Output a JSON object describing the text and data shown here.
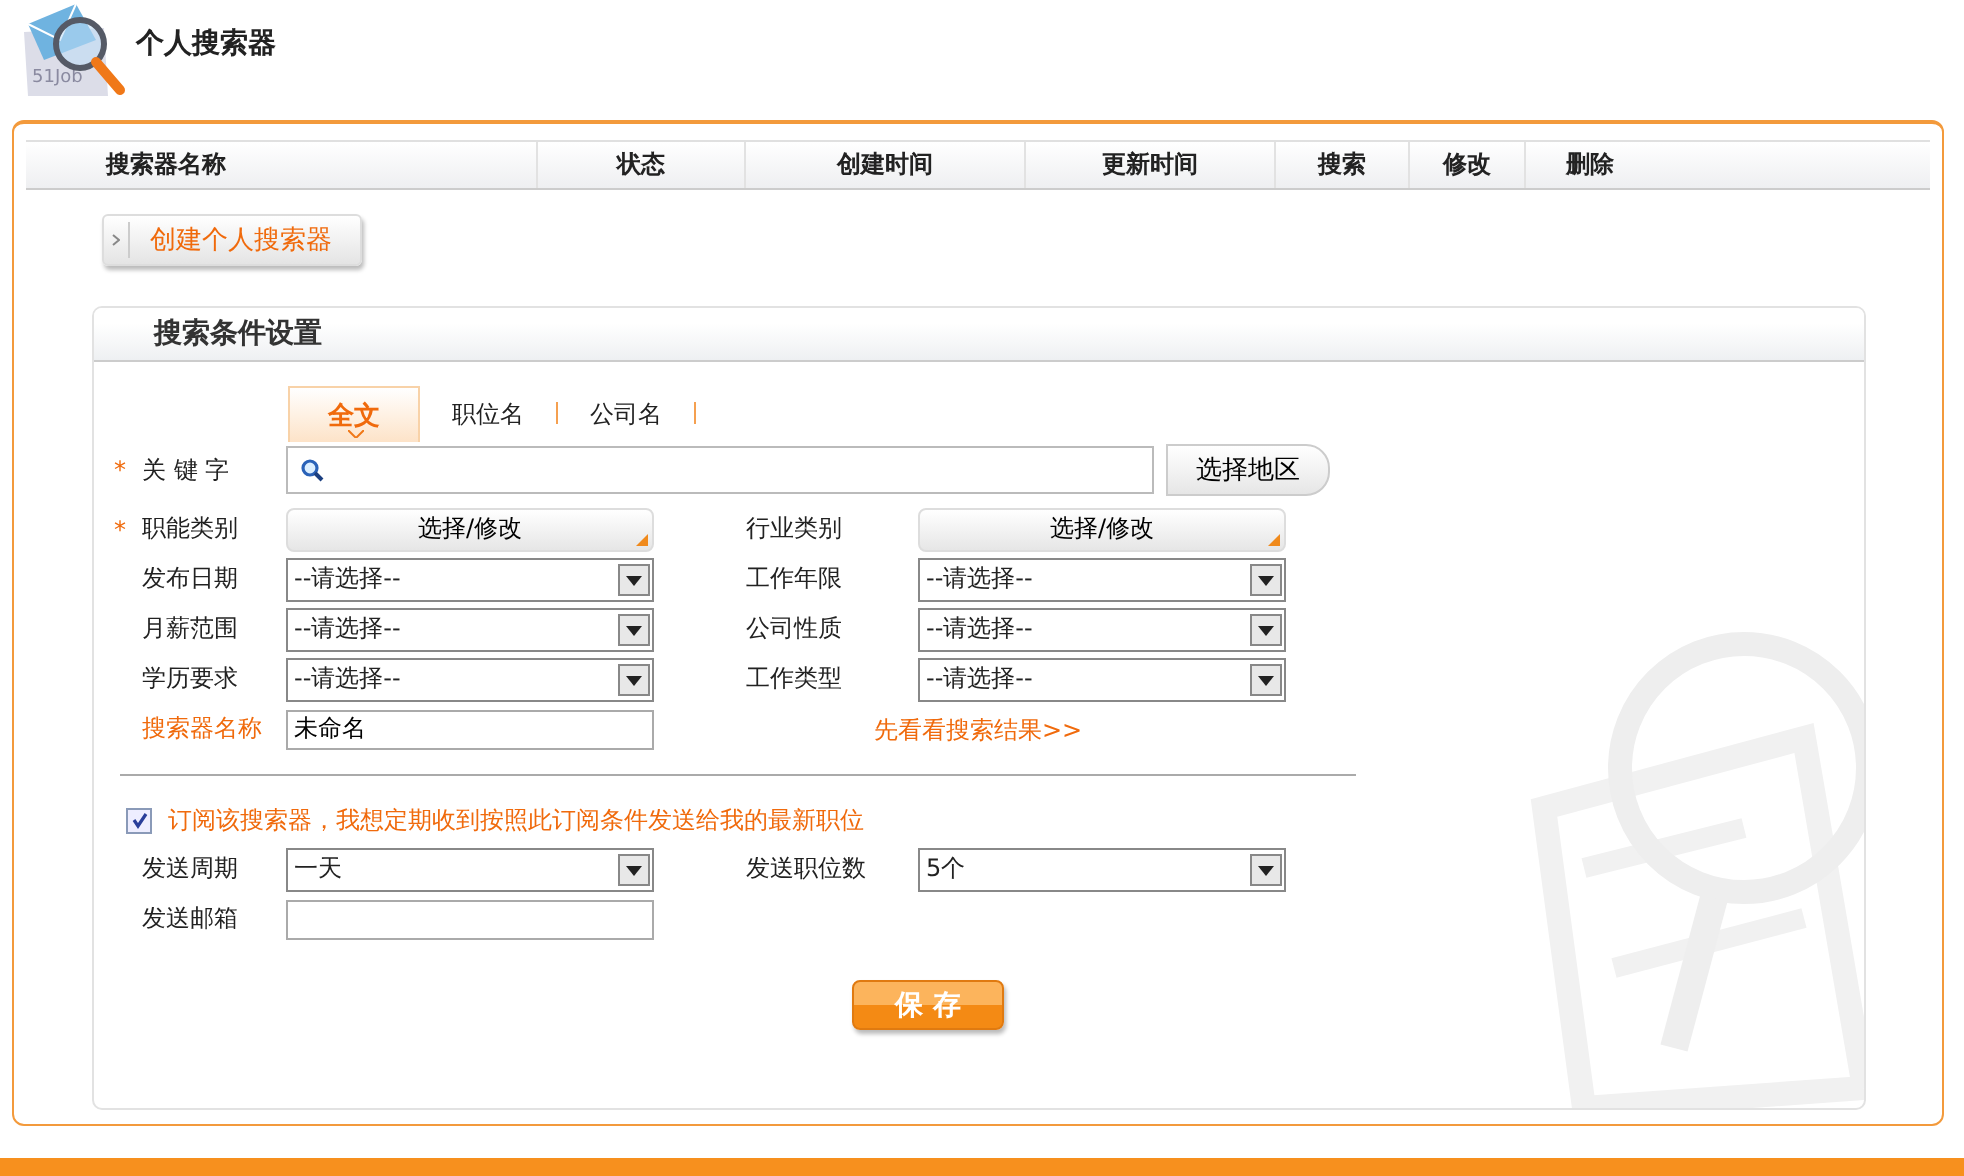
{
  "header": {
    "logo_text": "51Job",
    "title": "个人搜索器"
  },
  "table": {
    "columns": [
      "搜索器名称",
      "状态",
      "创建时间",
      "更新时间",
      "搜索",
      "修改",
      "删除"
    ]
  },
  "create_button": "创建个人搜索器",
  "search_settings": {
    "title": "搜索条件设置",
    "tabs": [
      {
        "label": "全文",
        "selected": true
      },
      {
        "label": "职位名",
        "selected": false
      },
      {
        "label": "公司名",
        "selected": false
      }
    ],
    "keyword": {
      "required_mark": "*",
      "label": "关 键 字",
      "region_button": "选择地区"
    },
    "rows": [
      {
        "left": {
          "kind": "picker",
          "required_mark": "*",
          "label": "职能类别",
          "value": "选择/修改"
        },
        "right": {
          "kind": "picker",
          "label": "行业类别",
          "value": "选择/修改"
        }
      },
      {
        "left": {
          "kind": "select",
          "label": "发布日期",
          "value": "--请选择--"
        },
        "right": {
          "kind": "select",
          "label": "工作年限",
          "value": "--请选择--"
        }
      },
      {
        "left": {
          "kind": "select",
          "label": "月薪范围",
          "value": "--请选择--"
        },
        "right": {
          "kind": "select",
          "label": "公司性质",
          "value": "--请选择--"
        }
      },
      {
        "left": {
          "kind": "select",
          "label": "学历要求",
          "value": "--请选择--"
        },
        "right": {
          "kind": "select",
          "label": "工作类型",
          "value": "--请选择--"
        }
      },
      {
        "left": {
          "kind": "text",
          "label": "搜索器名称",
          "highlight": true,
          "value": "未命名"
        },
        "right": {
          "kind": "link",
          "value": "先看看搜索结果>>"
        }
      }
    ]
  },
  "subscription": {
    "checked": true,
    "text": "订阅该搜索器，我想定期收到按照此订阅条件发送给我的最新职位",
    "rows": [
      {
        "left": {
          "kind": "select",
          "label": "发送周期",
          "value": "一天"
        },
        "right": {
          "kind": "select",
          "label": "发送职位数",
          "value": "5个"
        }
      },
      {
        "left": {
          "kind": "text",
          "label": "发送邮箱"
        }
      }
    ]
  },
  "save_button": "保 存"
}
